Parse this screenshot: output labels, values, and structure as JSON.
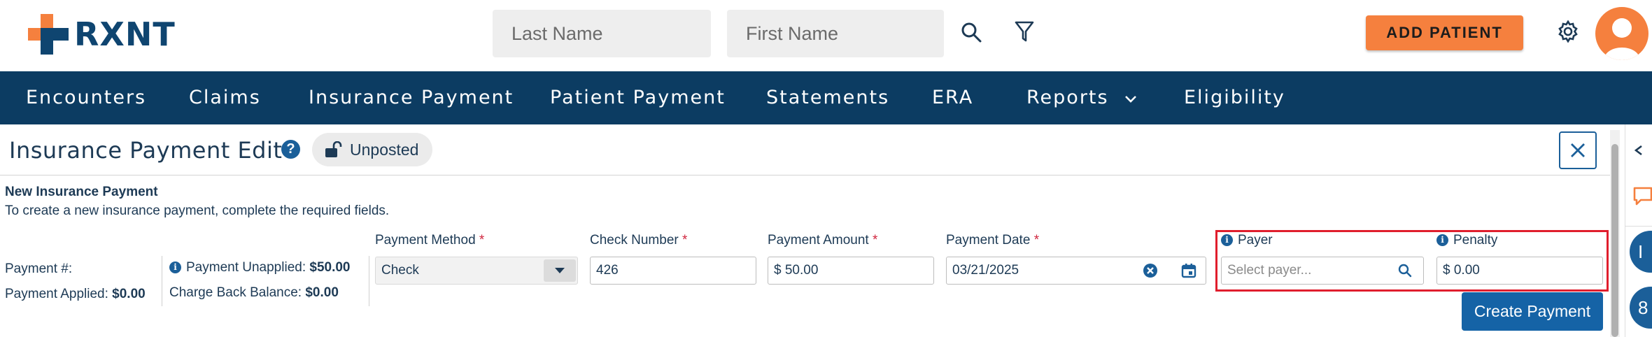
{
  "brand": {
    "logo_text": "RXNT",
    "accent": "#f5803e",
    "navy": "#0c3c62"
  },
  "header": {
    "last_name_placeholder": "Last Name",
    "first_name_placeholder": "First Name",
    "add_patient_label": "ADD PATIENT"
  },
  "nav": {
    "encounters": "Encounters",
    "claims": "Claims",
    "insurance_payment": "Insurance Payment",
    "patient_payment": "Patient Payment",
    "statements": "Statements",
    "era": "ERA",
    "reports": "Reports",
    "eligibility": "Eligibility"
  },
  "page": {
    "title": "Insurance Payment Edit",
    "help_glyph": "?",
    "status": "Unposted",
    "section_title": "New Insurance Payment",
    "section_subtitle": "To create a new insurance payment, complete the required fields."
  },
  "summary": {
    "payment_number_label": "Payment #:",
    "payment_applied_label": "Payment Applied:",
    "payment_applied_value": "$0.00",
    "payment_unapplied_label": "Payment Unapplied:",
    "payment_unapplied_value": "$50.00",
    "charge_back_label": "Charge Back Balance:",
    "charge_back_value": "$0.00"
  },
  "form": {
    "required_mark": "*",
    "payment_method_label": "Payment Method",
    "payment_method_value": "Check",
    "check_number_label": "Check Number",
    "check_number_value": "426",
    "payment_amount_label": "Payment Amount",
    "payment_amount_value": "$ 50.00",
    "payment_date_label": "Payment Date",
    "payment_date_value": "03/21/2025",
    "payer_label": "Payer",
    "payer_placeholder": "Select payer...",
    "penalty_label": "Penalty",
    "penalty_value": "$ 0.00",
    "create_button_label": "Create Payment"
  },
  "rail": {
    "item1": "I",
    "item2": "8"
  }
}
